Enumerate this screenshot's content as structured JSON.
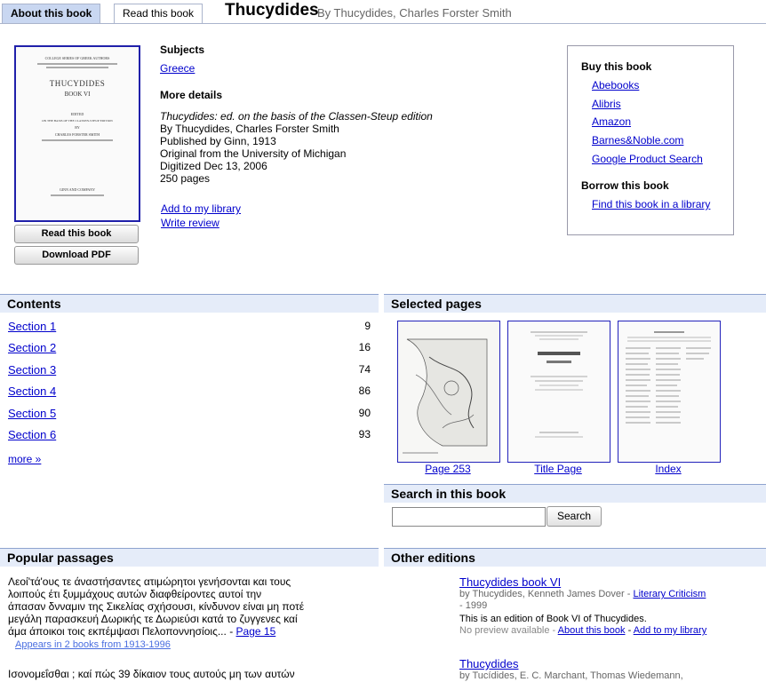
{
  "tabs": [
    {
      "label": "About this book"
    },
    {
      "label": "Read this book"
    }
  ],
  "book": {
    "title": "Thucydides",
    "byline": "By Thucydides, Charles Forster Smith"
  },
  "cover": {
    "line1": "COLLEGE SERIES OF GREEK AUTHORS",
    "title": "THUCYDIDES",
    "book": "BOOK VI",
    "edited": "EDITED",
    "note": "ON THE BASIS OF THE CLASSEN-STEUP EDITION",
    "by": "BY",
    "editor": "CHARLES FORSTER SMITH",
    "publisher": "GINN AND COMPANY"
  },
  "buttons": {
    "read": "Read this book",
    "download": "Download PDF"
  },
  "subjects": {
    "heading": "Subjects",
    "link": "Greece"
  },
  "details": {
    "heading": "More details",
    "edition": "Thucydides: ed. on the basis of the Classen-Steup edition",
    "authors": "By Thucydides, Charles Forster Smith",
    "published": "Published by Ginn, 1913",
    "original": "Original from the University of Michigan",
    "digitized": "Digitized Dec 13, 2006",
    "pages": "250 pages",
    "add_library": "Add to my library",
    "write_review": "Write review"
  },
  "buy": {
    "heading": "Buy this book",
    "links": [
      "Abebooks",
      "Alibris",
      "Amazon",
      "Barnes&Noble.com",
      "Google Product Search"
    ],
    "borrow_heading": "Borrow this book",
    "borrow_link": "Find this book in a library"
  },
  "contents": {
    "heading": "Contents",
    "rows": [
      {
        "label": "Section 1",
        "page": "9"
      },
      {
        "label": "Section 2",
        "page": "16"
      },
      {
        "label": "Section 3",
        "page": "74"
      },
      {
        "label": "Section 4",
        "page": "86"
      },
      {
        "label": "Section 5",
        "page": "90"
      },
      {
        "label": "Section 6",
        "page": "93"
      }
    ],
    "more": "more »"
  },
  "selected_pages": {
    "heading": "Selected pages",
    "captions": [
      "Page 253",
      "Title Page",
      "Index"
    ]
  },
  "search": {
    "heading": "Search in this book",
    "placeholder": "",
    "button": "Search"
  },
  "popular": {
    "heading": "Popular passages",
    "p1_lines": [
      "Λεοί'τά'ους τε άναστήσαντες ατιμώρητοι γενήσονται και τους",
      "λοιπούς έτι ξυμμάχους αυτών διαφθείροντες αυτοί την",
      "άπασαν δνναμιν της Σικελίας σχήσουσι, κίνδυνον είναι μη ποτέ",
      "μεγάλη παρασκευή Δωρικής τε Δωριεύσι κατά το ζυγγενες καί"
    ],
    "p1_last": "άμα άποικοι τοις εκπέμψασι Πελοποννησίοις...",
    "p1_sep": " - ",
    "p1_page": "Page 15",
    "p1_appears": "Appears in 2 books from 1913-1996",
    "p2_line1": "Ισονομεΐσθαι ; καί πώς 39 δίκαιον τους αυτούς μη των αυτών"
  },
  "other_editions": {
    "heading": "Other editions",
    "e1_title": "Thucydides book VI",
    "e1_by": "by Thucydides, Kenneth James Dover - ",
    "e1_subject": "Literary Criticism",
    "e1_year": "- 1999",
    "e1_desc": "This is an edition of Book VI of Thucydides.",
    "e1_nopreview": "No preview available - ",
    "e1_about": "About this book",
    "e1_sep": " - ",
    "e1_add": "Add to my library",
    "e2_title": "Thucydides",
    "e2_by": "by Tucídides, E. C. Marchant, Thomas Wiedemann,"
  }
}
